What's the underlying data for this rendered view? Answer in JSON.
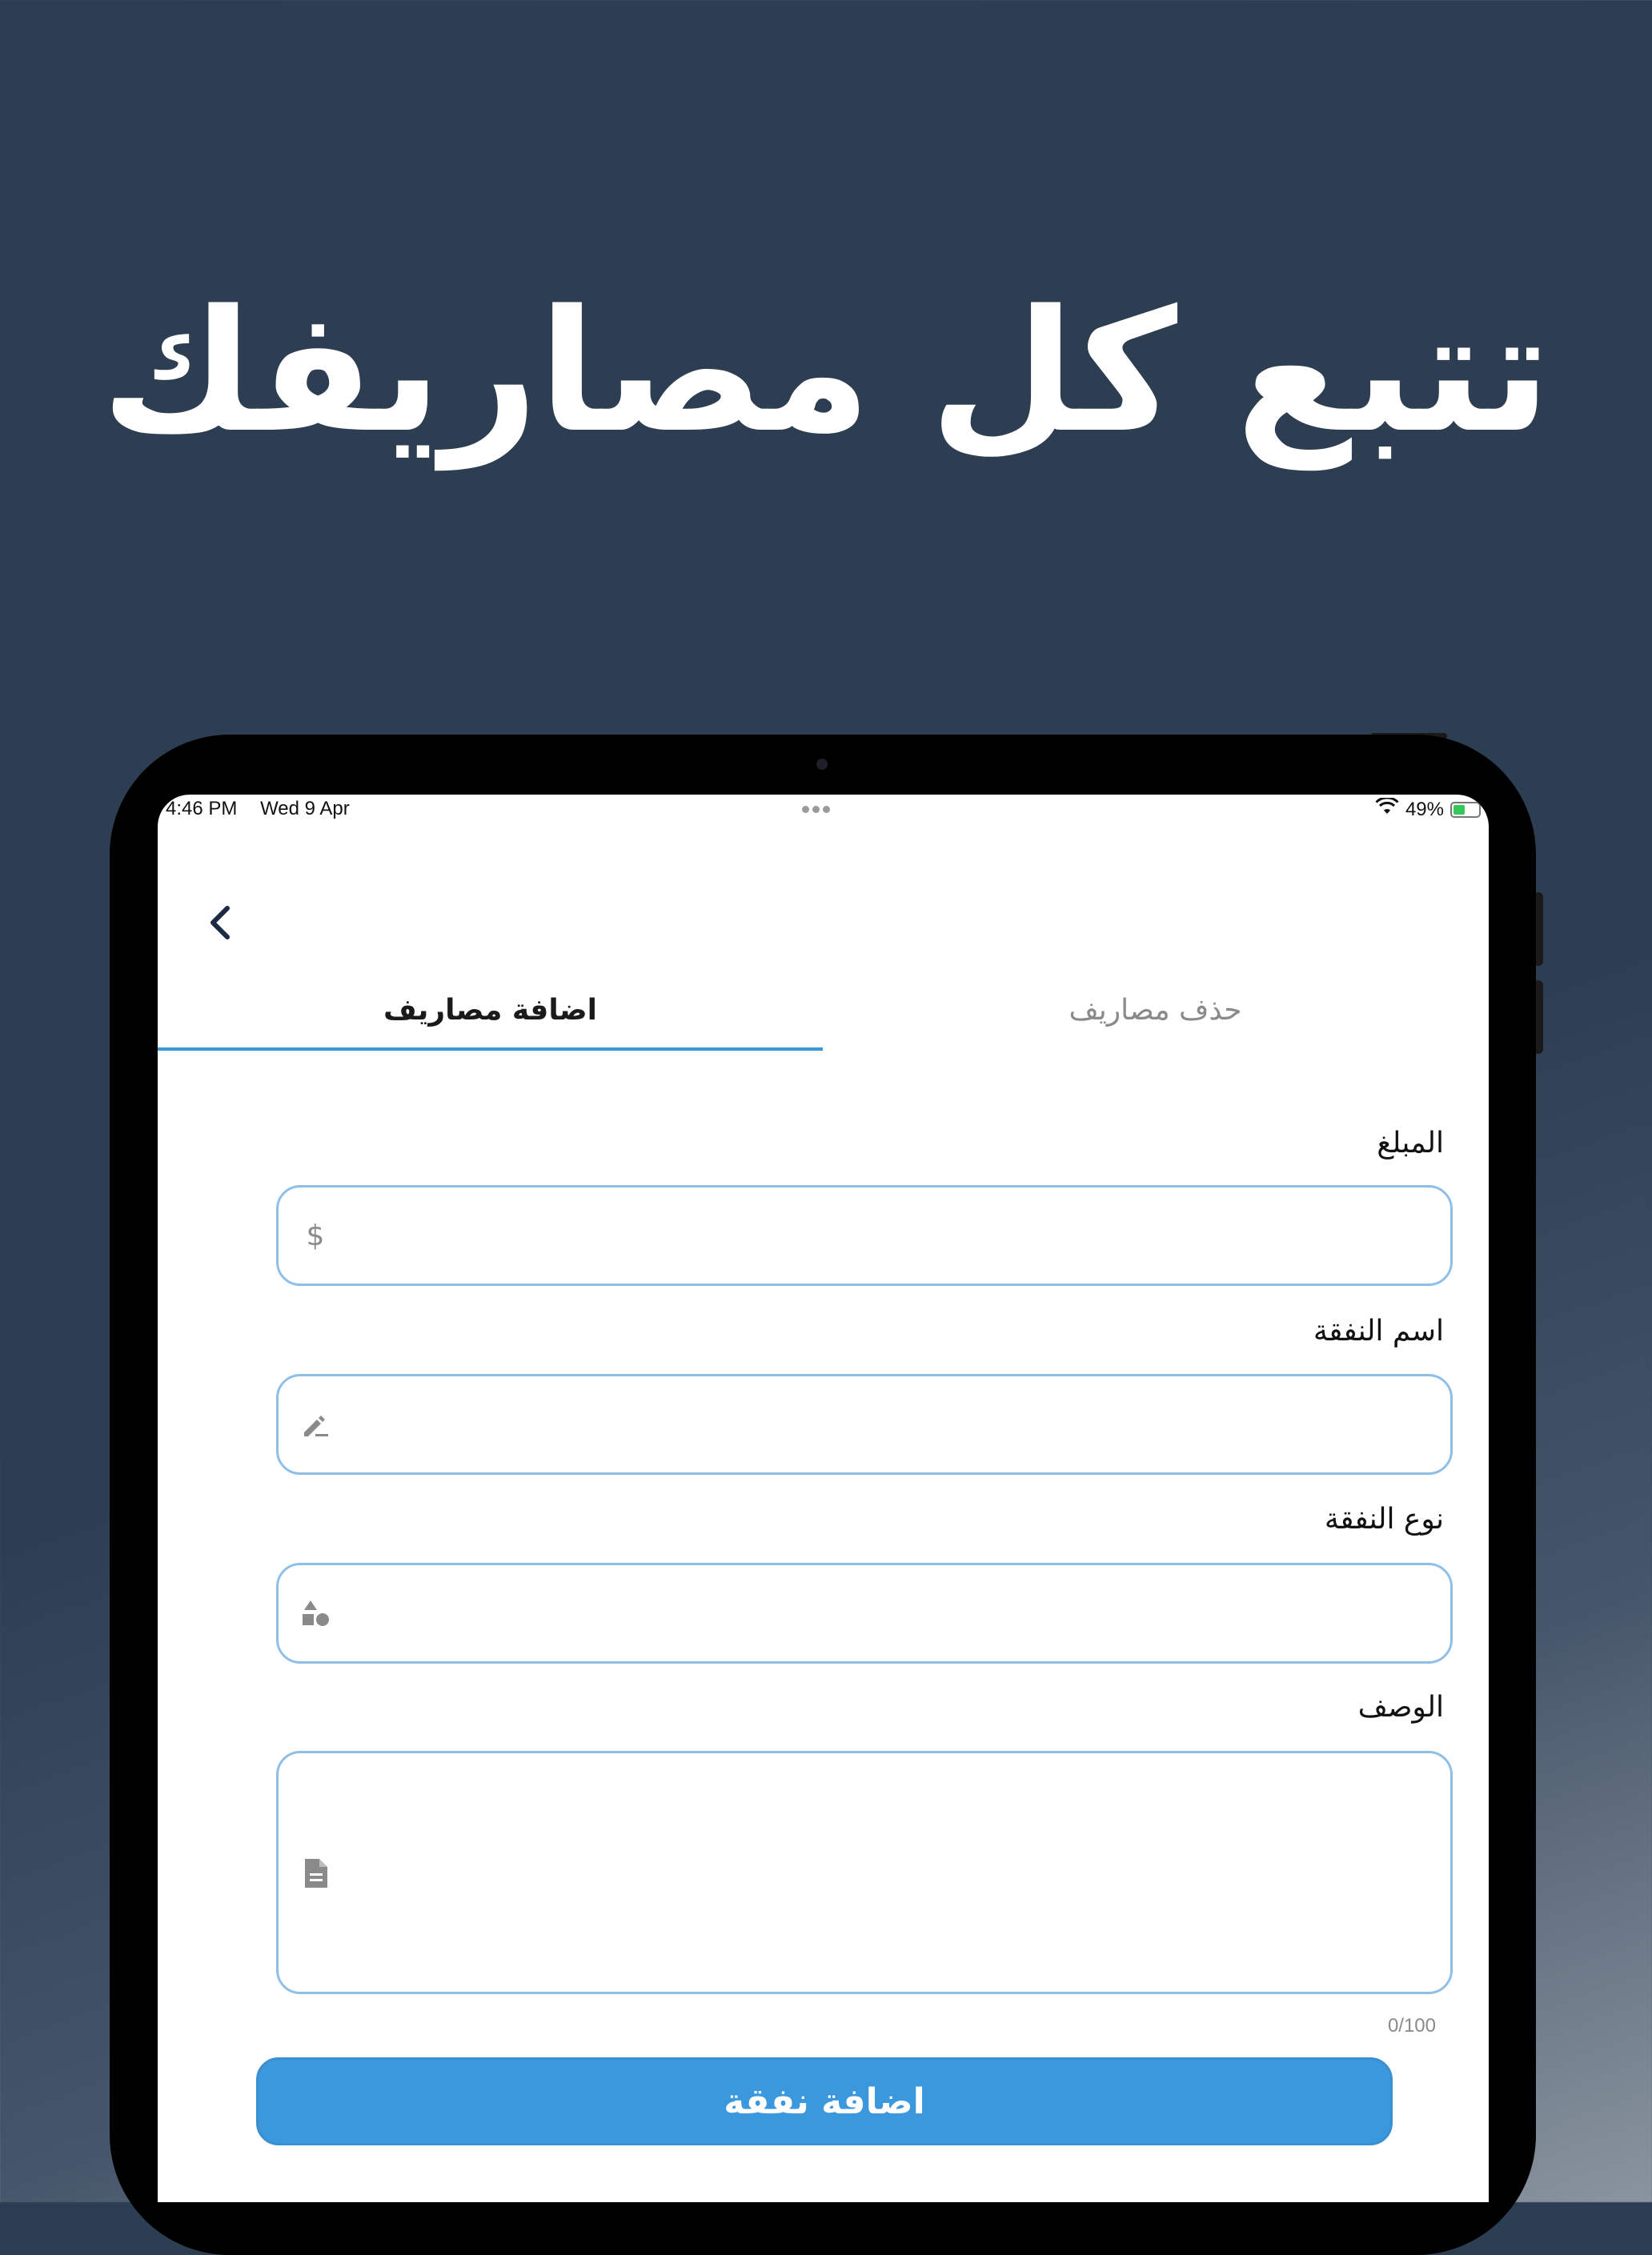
{
  "promo": {
    "headline": "تتبع كل مصاريفك"
  },
  "status_bar": {
    "time": "4:46 PM",
    "date": "Wed 9 Apr",
    "battery": "49%"
  },
  "tabs": {
    "add_label": "اضافة مصاريف",
    "delete_label": "حذف مصاريف",
    "active": "add"
  },
  "form": {
    "amount": {
      "label": "المبلغ",
      "value": "",
      "icon": "dollar-icon"
    },
    "expense_name": {
      "label": "اسم النفقة",
      "value": "",
      "icon": "edit-icon"
    },
    "expense_type": {
      "label": "نوع النفقة",
      "value": "",
      "icon": "category-icon"
    },
    "description": {
      "label": "الوصف",
      "value": "",
      "icon": "document-icon",
      "counter": "0/100"
    },
    "submit_label": "اضافة نفقة"
  },
  "colors": {
    "accent": "#3c98dc",
    "field_border": "#8fbfe8",
    "background": "#2e3e52"
  }
}
